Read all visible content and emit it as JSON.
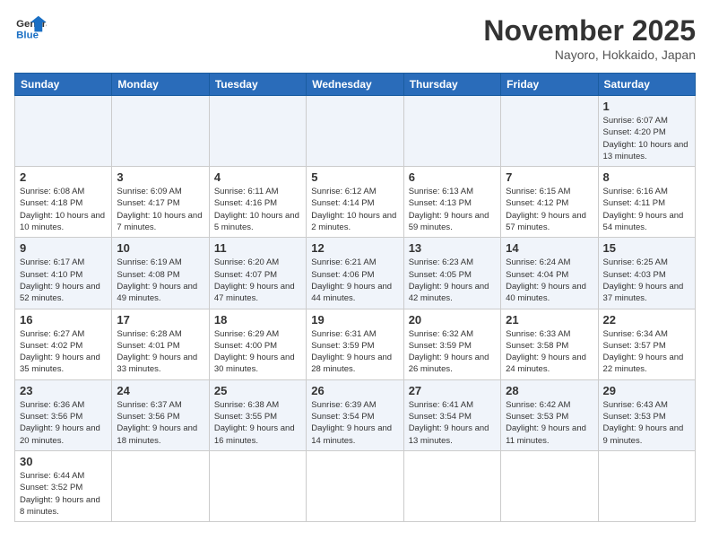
{
  "header": {
    "logo_general": "General",
    "logo_blue": "Blue",
    "month_title": "November 2025",
    "location": "Nayoro, Hokkaido, Japan"
  },
  "weekdays": [
    "Sunday",
    "Monday",
    "Tuesday",
    "Wednesday",
    "Thursday",
    "Friday",
    "Saturday"
  ],
  "weeks": [
    [
      {
        "day": "",
        "info": ""
      },
      {
        "day": "",
        "info": ""
      },
      {
        "day": "",
        "info": ""
      },
      {
        "day": "",
        "info": ""
      },
      {
        "day": "",
        "info": ""
      },
      {
        "day": "",
        "info": ""
      },
      {
        "day": "1",
        "info": "Sunrise: 6:07 AM\nSunset: 4:20 PM\nDaylight: 10 hours and 13 minutes."
      }
    ],
    [
      {
        "day": "2",
        "info": "Sunrise: 6:08 AM\nSunset: 4:18 PM\nDaylight: 10 hours and 10 minutes."
      },
      {
        "day": "3",
        "info": "Sunrise: 6:09 AM\nSunset: 4:17 PM\nDaylight: 10 hours and 7 minutes."
      },
      {
        "day": "4",
        "info": "Sunrise: 6:11 AM\nSunset: 4:16 PM\nDaylight: 10 hours and 5 minutes."
      },
      {
        "day": "5",
        "info": "Sunrise: 6:12 AM\nSunset: 4:14 PM\nDaylight: 10 hours and 2 minutes."
      },
      {
        "day": "6",
        "info": "Sunrise: 6:13 AM\nSunset: 4:13 PM\nDaylight: 9 hours and 59 minutes."
      },
      {
        "day": "7",
        "info": "Sunrise: 6:15 AM\nSunset: 4:12 PM\nDaylight: 9 hours and 57 minutes."
      },
      {
        "day": "8",
        "info": "Sunrise: 6:16 AM\nSunset: 4:11 PM\nDaylight: 9 hours and 54 minutes."
      }
    ],
    [
      {
        "day": "9",
        "info": "Sunrise: 6:17 AM\nSunset: 4:10 PM\nDaylight: 9 hours and 52 minutes."
      },
      {
        "day": "10",
        "info": "Sunrise: 6:19 AM\nSunset: 4:08 PM\nDaylight: 9 hours and 49 minutes."
      },
      {
        "day": "11",
        "info": "Sunrise: 6:20 AM\nSunset: 4:07 PM\nDaylight: 9 hours and 47 minutes."
      },
      {
        "day": "12",
        "info": "Sunrise: 6:21 AM\nSunset: 4:06 PM\nDaylight: 9 hours and 44 minutes."
      },
      {
        "day": "13",
        "info": "Sunrise: 6:23 AM\nSunset: 4:05 PM\nDaylight: 9 hours and 42 minutes."
      },
      {
        "day": "14",
        "info": "Sunrise: 6:24 AM\nSunset: 4:04 PM\nDaylight: 9 hours and 40 minutes."
      },
      {
        "day": "15",
        "info": "Sunrise: 6:25 AM\nSunset: 4:03 PM\nDaylight: 9 hours and 37 minutes."
      }
    ],
    [
      {
        "day": "16",
        "info": "Sunrise: 6:27 AM\nSunset: 4:02 PM\nDaylight: 9 hours and 35 minutes."
      },
      {
        "day": "17",
        "info": "Sunrise: 6:28 AM\nSunset: 4:01 PM\nDaylight: 9 hours and 33 minutes."
      },
      {
        "day": "18",
        "info": "Sunrise: 6:29 AM\nSunset: 4:00 PM\nDaylight: 9 hours and 30 minutes."
      },
      {
        "day": "19",
        "info": "Sunrise: 6:31 AM\nSunset: 3:59 PM\nDaylight: 9 hours and 28 minutes."
      },
      {
        "day": "20",
        "info": "Sunrise: 6:32 AM\nSunset: 3:59 PM\nDaylight: 9 hours and 26 minutes."
      },
      {
        "day": "21",
        "info": "Sunrise: 6:33 AM\nSunset: 3:58 PM\nDaylight: 9 hours and 24 minutes."
      },
      {
        "day": "22",
        "info": "Sunrise: 6:34 AM\nSunset: 3:57 PM\nDaylight: 9 hours and 22 minutes."
      }
    ],
    [
      {
        "day": "23",
        "info": "Sunrise: 6:36 AM\nSunset: 3:56 PM\nDaylight: 9 hours and 20 minutes."
      },
      {
        "day": "24",
        "info": "Sunrise: 6:37 AM\nSunset: 3:56 PM\nDaylight: 9 hours and 18 minutes."
      },
      {
        "day": "25",
        "info": "Sunrise: 6:38 AM\nSunset: 3:55 PM\nDaylight: 9 hours and 16 minutes."
      },
      {
        "day": "26",
        "info": "Sunrise: 6:39 AM\nSunset: 3:54 PM\nDaylight: 9 hours and 14 minutes."
      },
      {
        "day": "27",
        "info": "Sunrise: 6:41 AM\nSunset: 3:54 PM\nDaylight: 9 hours and 13 minutes."
      },
      {
        "day": "28",
        "info": "Sunrise: 6:42 AM\nSunset: 3:53 PM\nDaylight: 9 hours and 11 minutes."
      },
      {
        "day": "29",
        "info": "Sunrise: 6:43 AM\nSunset: 3:53 PM\nDaylight: 9 hours and 9 minutes."
      }
    ],
    [
      {
        "day": "30",
        "info": "Sunrise: 6:44 AM\nSunset: 3:52 PM\nDaylight: 9 hours and 8 minutes."
      },
      {
        "day": "",
        "info": ""
      },
      {
        "day": "",
        "info": ""
      },
      {
        "day": "",
        "info": ""
      },
      {
        "day": "",
        "info": ""
      },
      {
        "day": "",
        "info": ""
      },
      {
        "day": "",
        "info": ""
      }
    ]
  ]
}
